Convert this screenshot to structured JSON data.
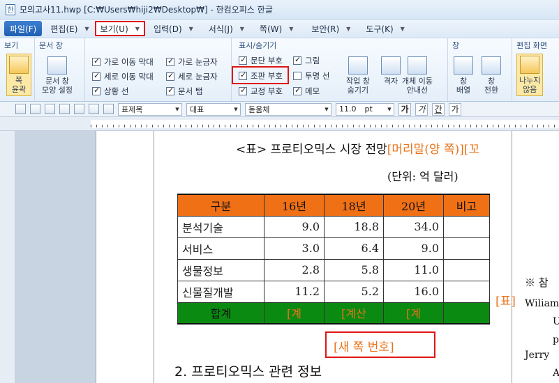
{
  "window": {
    "title": "모의고사11.hwp [C:₩Users₩hiji2₩Desktop₩] - 한컴오피스 한글"
  },
  "menu": {
    "file": "파일(F)",
    "items": [
      "편집(E)",
      "보기(U)",
      "입력(D)",
      "서식(J)",
      "쪽(W)",
      "보안(R)",
      "도구(K)"
    ],
    "selected": "보기(U)"
  },
  "ribbon": {
    "view": {
      "title": "보기",
      "zoom_label": "쪽\n윤곽"
    },
    "docwin": {
      "title": "문서 창",
      "btn_label": "문서 창\n모양 설정"
    },
    "bars": {
      "col1": [
        "가로 이동 막대",
        "세로 이동 막대",
        "상황 선"
      ],
      "col2": [
        "가로 눈금자",
        "세로 눈금자",
        "문서 탭"
      ]
    },
    "show": {
      "title": "표시/숨기기",
      "col1": [
        "문단 부호",
        "조판 부호",
        "교정 부호"
      ],
      "col2": [
        "그림",
        "투명 선",
        "메모"
      ],
      "btns": [
        "작업 창\n숨기기",
        "격자",
        "개체 이동\n안내선"
      ]
    },
    "window": {
      "title": "창",
      "btns": [
        "창\n배열",
        "창\n전환"
      ]
    },
    "edit": {
      "title": "편집 화면",
      "btn": "나누지\n않음"
    }
  },
  "toolbar": {
    "style": "표제목",
    "lang": "대표",
    "font": "돋움체",
    "size": "11.0",
    "unit": "pt",
    "fmt": [
      "가",
      "가",
      "간",
      "가"
    ]
  },
  "document": {
    "title": "<표> 프로티오믹스 시장 전망",
    "title_orange": "[머리말(양 쪽)][꼬",
    "unit": "(단위: 억 달러)",
    "table": {
      "headers": [
        "구분",
        "16년",
        "18년",
        "20년",
        "비고"
      ],
      "rows": [
        [
          "분석기술",
          "9.0",
          "18.8",
          "34.0",
          ""
        ],
        [
          "서비스",
          "3.0",
          "6.4",
          "9.0",
          ""
        ],
        [
          "생물정보",
          "2.8",
          "5.8",
          "11.0",
          ""
        ],
        [
          "신물질개발",
          "11.2",
          "5.2",
          "16.0",
          ""
        ]
      ],
      "total": [
        "합계",
        "[계",
        "[계산",
        "[계",
        ""
      ]
    },
    "page_number": "[새 쪽 번호]",
    "section": "2. 프로티오믹스 관련 정보",
    "side_label": "[표]",
    "right_notes": [
      "※ 참",
      "Wiliam",
      "U",
      "p",
      "Jerry",
      "A"
    ]
  }
}
